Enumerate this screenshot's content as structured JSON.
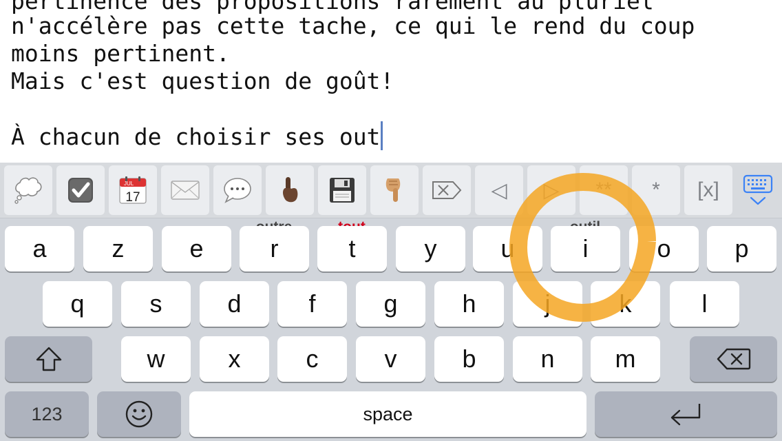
{
  "editor": {
    "lines": [
      "pertinence des propositions rarement au pluriel",
      "n'accélère pas cette tache, ce qui le rend du coup",
      "moins pertinent.",
      "Mais c'est question de goût!",
      "",
      "À chacun de choisir ses out"
    ]
  },
  "toolbar": {
    "items": [
      {
        "name": "thought-bubble-icon"
      },
      {
        "name": "checkbox-icon"
      },
      {
        "name": "calendar-icon",
        "month": "JUL",
        "day": "17"
      },
      {
        "name": "envelope-icon"
      },
      {
        "name": "speech-bubble-icon"
      },
      {
        "name": "hand-pointer-icon"
      },
      {
        "name": "floppy-disk-icon"
      },
      {
        "name": "hand-down-icon"
      },
      {
        "name": "delete-forward-icon"
      },
      {
        "name": "triangle-left-icon",
        "glyph": "◁"
      },
      {
        "name": "triangle-right-icon",
        "glyph": "▷"
      },
      {
        "name": "bold-markup-button",
        "label": "**"
      },
      {
        "name": "italic-markup-button",
        "label": "*"
      },
      {
        "name": "link-markup-button",
        "label": "[x]"
      },
      {
        "name": "keyboard-dismiss-icon"
      }
    ]
  },
  "suggestions": {
    "r": "outre",
    "t": "tout",
    "i": "outil"
  },
  "keys": {
    "row1": [
      "a",
      "z",
      "e",
      "r",
      "t",
      "y",
      "u",
      "i",
      "o",
      "p"
    ],
    "row2": [
      "q",
      "s",
      "d",
      "f",
      "g",
      "h",
      "j",
      "k",
      "l"
    ],
    "row3": [
      "w",
      "x",
      "c",
      "v",
      "b",
      "n",
      "m"
    ],
    "numbers_label": "123",
    "space_label": "space"
  },
  "colors": {
    "accent_orange": "#f5a623",
    "suggestion_red": "#d0021b",
    "caret": "#5a7fc2",
    "keyboard_bg": "#d1d5db"
  }
}
